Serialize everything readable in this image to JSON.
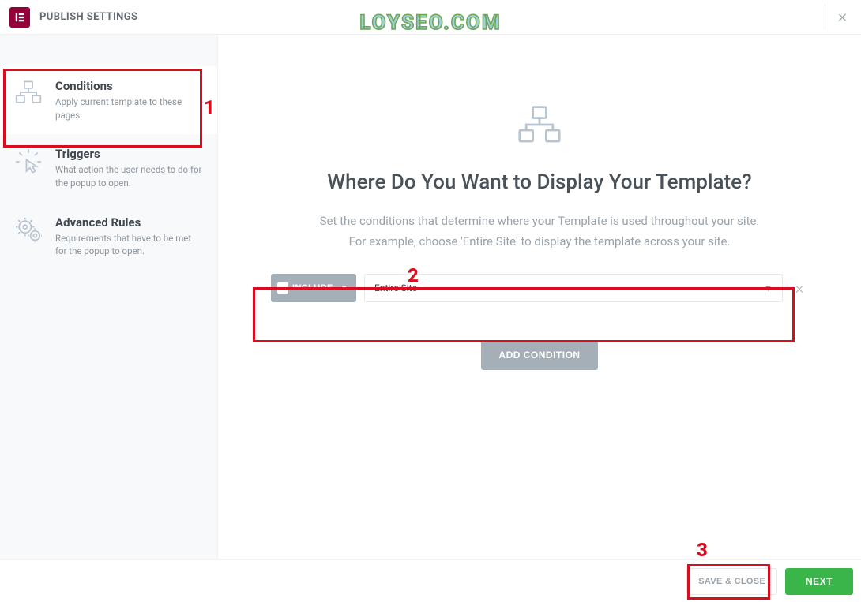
{
  "header": {
    "title": "PUBLISH SETTINGS"
  },
  "watermark": "LOYSEO.COM",
  "sidebar": {
    "items": [
      {
        "title": "Conditions",
        "desc": "Apply current template to these pages."
      },
      {
        "title": "Triggers",
        "desc": "What action the user needs to do for the popup to open."
      },
      {
        "title": "Advanced Rules",
        "desc": "Requirements that have to be met for the popup to open."
      }
    ]
  },
  "main": {
    "heading": "Where Do You Want to Display Your Template?",
    "sub1": "Set the conditions that determine where your Template is used throughout your site.",
    "sub2": "For example, choose 'Entire Site' to display the template across your site.",
    "include_label": "INCLUDE",
    "select_value": "Entire Site",
    "add_label": "ADD CONDITION"
  },
  "footer": {
    "save_close": "SAVE & CLOSE",
    "next": "NEXT"
  },
  "annotations": {
    "n1": "1",
    "n2": "2",
    "n3": "3"
  }
}
